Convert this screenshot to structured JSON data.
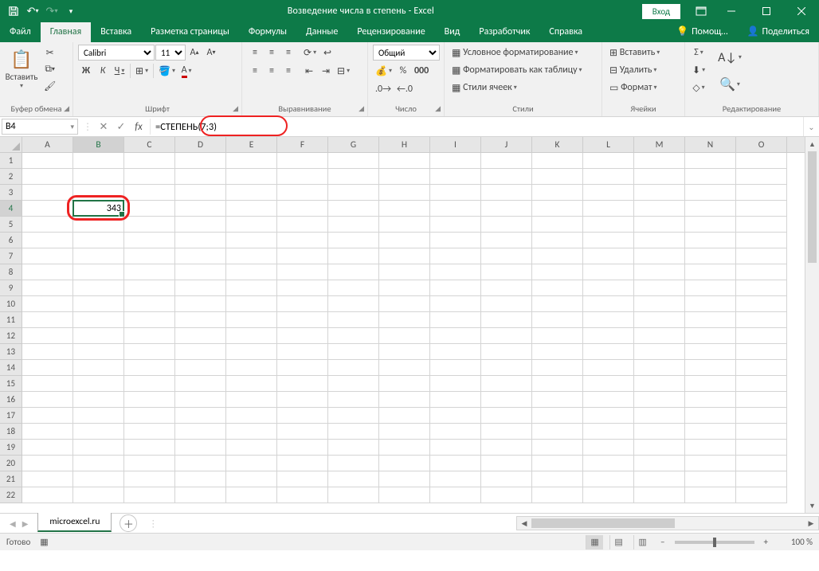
{
  "titlebar": {
    "title": "Возведение числа в степень  -  Excel",
    "login": "Вход"
  },
  "tabs": {
    "file": "Файл",
    "items": [
      "Главная",
      "Вставка",
      "Разметка страницы",
      "Формулы",
      "Данные",
      "Рецензирование",
      "Вид",
      "Разработчик",
      "Справка"
    ],
    "active_index": 0,
    "tell_me": "Помощ…",
    "share": "Поделиться"
  },
  "ribbon": {
    "clipboard": {
      "paste": "Вставить",
      "label": "Буфер обмена"
    },
    "font": {
      "name": "Calibri",
      "size": "11",
      "bold": "Ж",
      "italic": "К",
      "underline": "Ч",
      "label": "Шрифт"
    },
    "alignment": {
      "label": "Выравнивание"
    },
    "number": {
      "format": "Общий",
      "label": "Число"
    },
    "styles": {
      "cond": "Условное форматирование",
      "table": "Форматировать как таблицу",
      "cell": "Стили ячеек",
      "label": "Стили"
    },
    "cells": {
      "insert": "Вставить",
      "delete": "Удалить",
      "format": "Формат",
      "label": "Ячейки"
    },
    "editing": {
      "label": "Редактирование"
    }
  },
  "formula_bar": {
    "name_box": "B4",
    "formula": "=СТЕПЕНЬ(7;3)"
  },
  "grid": {
    "columns": [
      "A",
      "B",
      "C",
      "D",
      "E",
      "F",
      "G",
      "H",
      "I",
      "J",
      "K",
      "L",
      "M",
      "N",
      "O"
    ],
    "rows": 22,
    "active": {
      "col": "B",
      "row": 4
    },
    "value_b4": "343"
  },
  "sheets": {
    "active": "microexcel.ru"
  },
  "status": {
    "ready": "Готово",
    "zoom": "100 %"
  }
}
